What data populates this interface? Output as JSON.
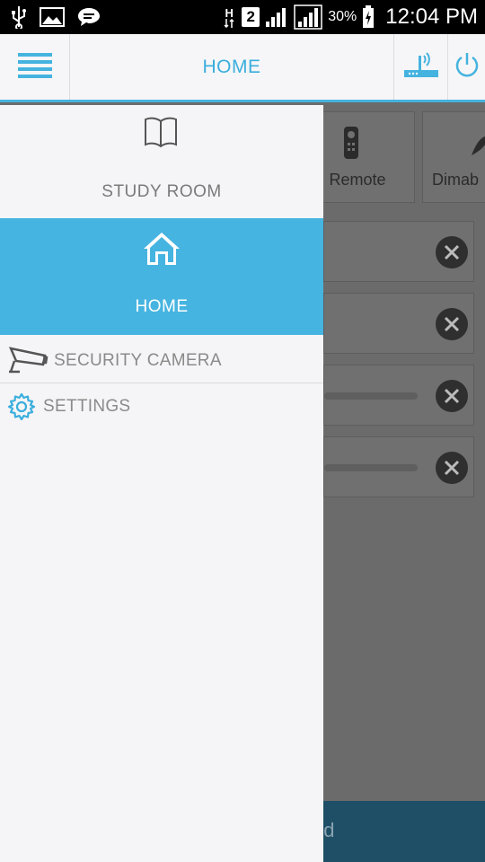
{
  "status_bar": {
    "network_letter": "H",
    "sim_slot": "2",
    "battery_percent": "30%",
    "time": "12:04 PM"
  },
  "header": {
    "title": "HOME"
  },
  "background": {
    "tiles": [
      "Remote",
      "Dimab"
    ],
    "bottom_text": "od"
  },
  "drawer": {
    "items": [
      {
        "label": "STUDY ROOM",
        "icon": "book-icon",
        "selected": false
      },
      {
        "label": "HOME",
        "icon": "home-icon",
        "selected": true
      },
      {
        "label": "SECURITY CAMERA",
        "icon": "camera-icon",
        "selected": false
      },
      {
        "label": "SETTINGS",
        "icon": "gear-icon",
        "selected": false
      }
    ]
  },
  "colors": {
    "accent": "#45b3df",
    "drawer_bg": "#f5f5f7",
    "overlay": "#6b6b6b"
  }
}
